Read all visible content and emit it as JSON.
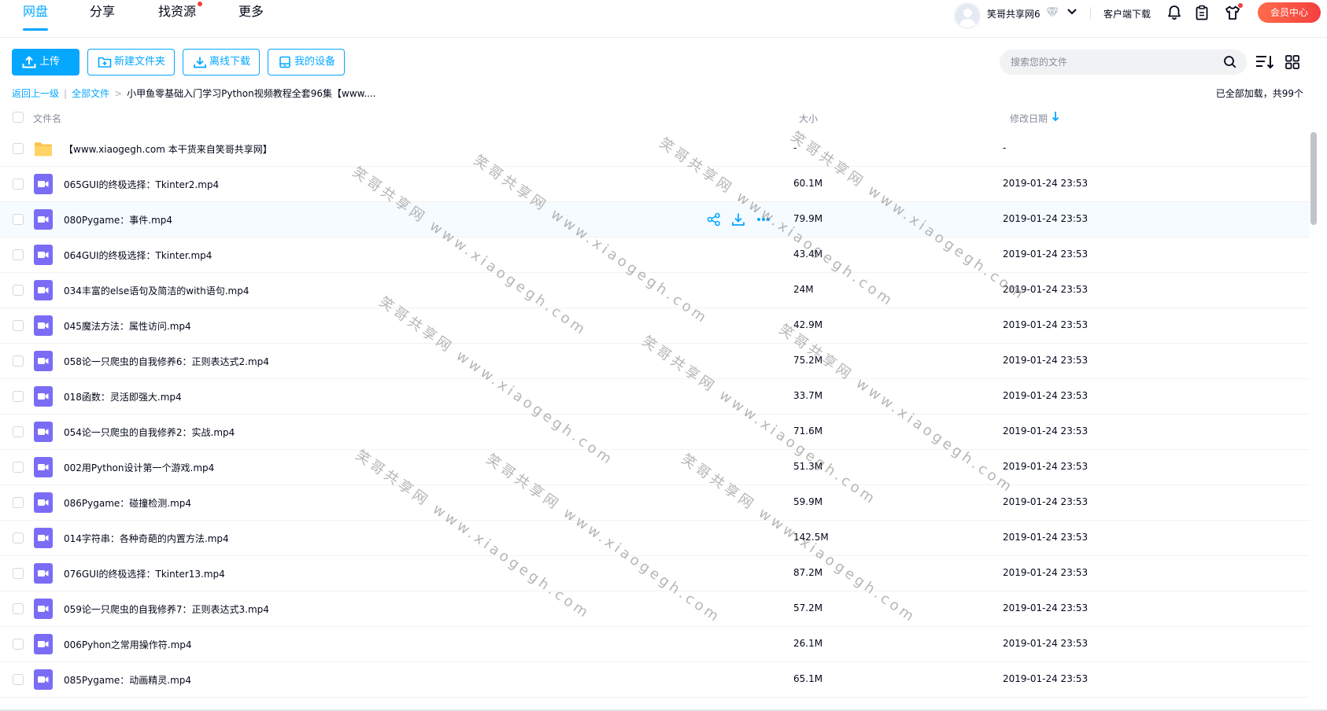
{
  "nav": {
    "tabs": [
      {
        "label": "网盘",
        "active": true
      },
      {
        "label": "分享",
        "active": false
      },
      {
        "label": "找资源",
        "active": false,
        "badge_dot": true
      },
      {
        "label": "更多",
        "active": false
      }
    ],
    "username": "笑哥共享网6",
    "client_download": "客户端下载",
    "vip_center": "会员中心",
    "icons": [
      "bell-icon",
      "clipboard-icon",
      "shirt-icon"
    ],
    "accent_color": "#06a7ff"
  },
  "toolbar": {
    "upload": "上传",
    "new_folder": "新建文件夹",
    "offline_download": "离线下载",
    "my_devices": "我的设备",
    "search_placeholder": "搜索您的文件"
  },
  "breadcrumb": {
    "back": "返回上一级",
    "all_files": "全部文件",
    "current": "小甲鱼零基础入门学习Python视频教程全套96集【www...."
  },
  "loaded_info": "已全部加载，共99个",
  "table": {
    "columns": {
      "name": "文件名",
      "size": "大小",
      "modified": "修改日期"
    },
    "rows": [
      {
        "type": "folder",
        "name": "【www.xiaogegh.com 本干货来自笑哥共享网】",
        "size": "-",
        "date": "-"
      },
      {
        "type": "video",
        "name": "065GUI的终极选择：Tkinter2.mp4",
        "size": "60.1M",
        "date": "2019-01-24 23:53"
      },
      {
        "type": "video",
        "name": "080Pygame：事件.mp4",
        "size": "79.9M",
        "date": "2019-01-24 23:53",
        "hover": true
      },
      {
        "type": "video",
        "name": "064GUI的终极选择：Tkinter.mp4",
        "size": "43.4M",
        "date": "2019-01-24 23:53"
      },
      {
        "type": "video",
        "name": "034丰富的else语句及简洁的with语句.mp4",
        "size": "24M",
        "date": "2019-01-24 23:53"
      },
      {
        "type": "video",
        "name": "045魔法方法：属性访问.mp4",
        "size": "42.9M",
        "date": "2019-01-24 23:53"
      },
      {
        "type": "video",
        "name": "058论一只爬虫的自我修养6：正则表达式2.mp4",
        "size": "75.2M",
        "date": "2019-01-24 23:53"
      },
      {
        "type": "video",
        "name": "018函数：灵活即强大.mp4",
        "size": "33.7M",
        "date": "2019-01-24 23:53"
      },
      {
        "type": "video",
        "name": "054论一只爬虫的自我修养2：实战.mp4",
        "size": "71.6M",
        "date": "2019-01-24 23:53"
      },
      {
        "type": "video",
        "name": "002用Python设计第一个游戏.mp4",
        "size": "51.3M",
        "date": "2019-01-24 23:53"
      },
      {
        "type": "video",
        "name": "086Pygame：碰撞检测.mp4",
        "size": "59.9M",
        "date": "2019-01-24 23:53"
      },
      {
        "type": "video",
        "name": "014字符串：各种奇葩的内置方法.mp4",
        "size": "142.5M",
        "date": "2019-01-24 23:53"
      },
      {
        "type": "video",
        "name": "076GUI的终极选择：Tkinter13.mp4",
        "size": "87.2M",
        "date": "2019-01-24 23:53"
      },
      {
        "type": "video",
        "name": "059论一只爬虫的自我修养7：正则表达式3.mp4",
        "size": "57.2M",
        "date": "2019-01-24 23:53"
      },
      {
        "type": "video",
        "name": "006Pyhon之常用操作符.mp4",
        "size": "26.1M",
        "date": "2019-01-24 23:53"
      },
      {
        "type": "video",
        "name": "085Pygame：动画精灵.mp4",
        "size": "65.1M",
        "date": "2019-01-24 23:53"
      }
    ]
  },
  "watermark_text": "笑哥共享网 www.xiaogegh.com"
}
